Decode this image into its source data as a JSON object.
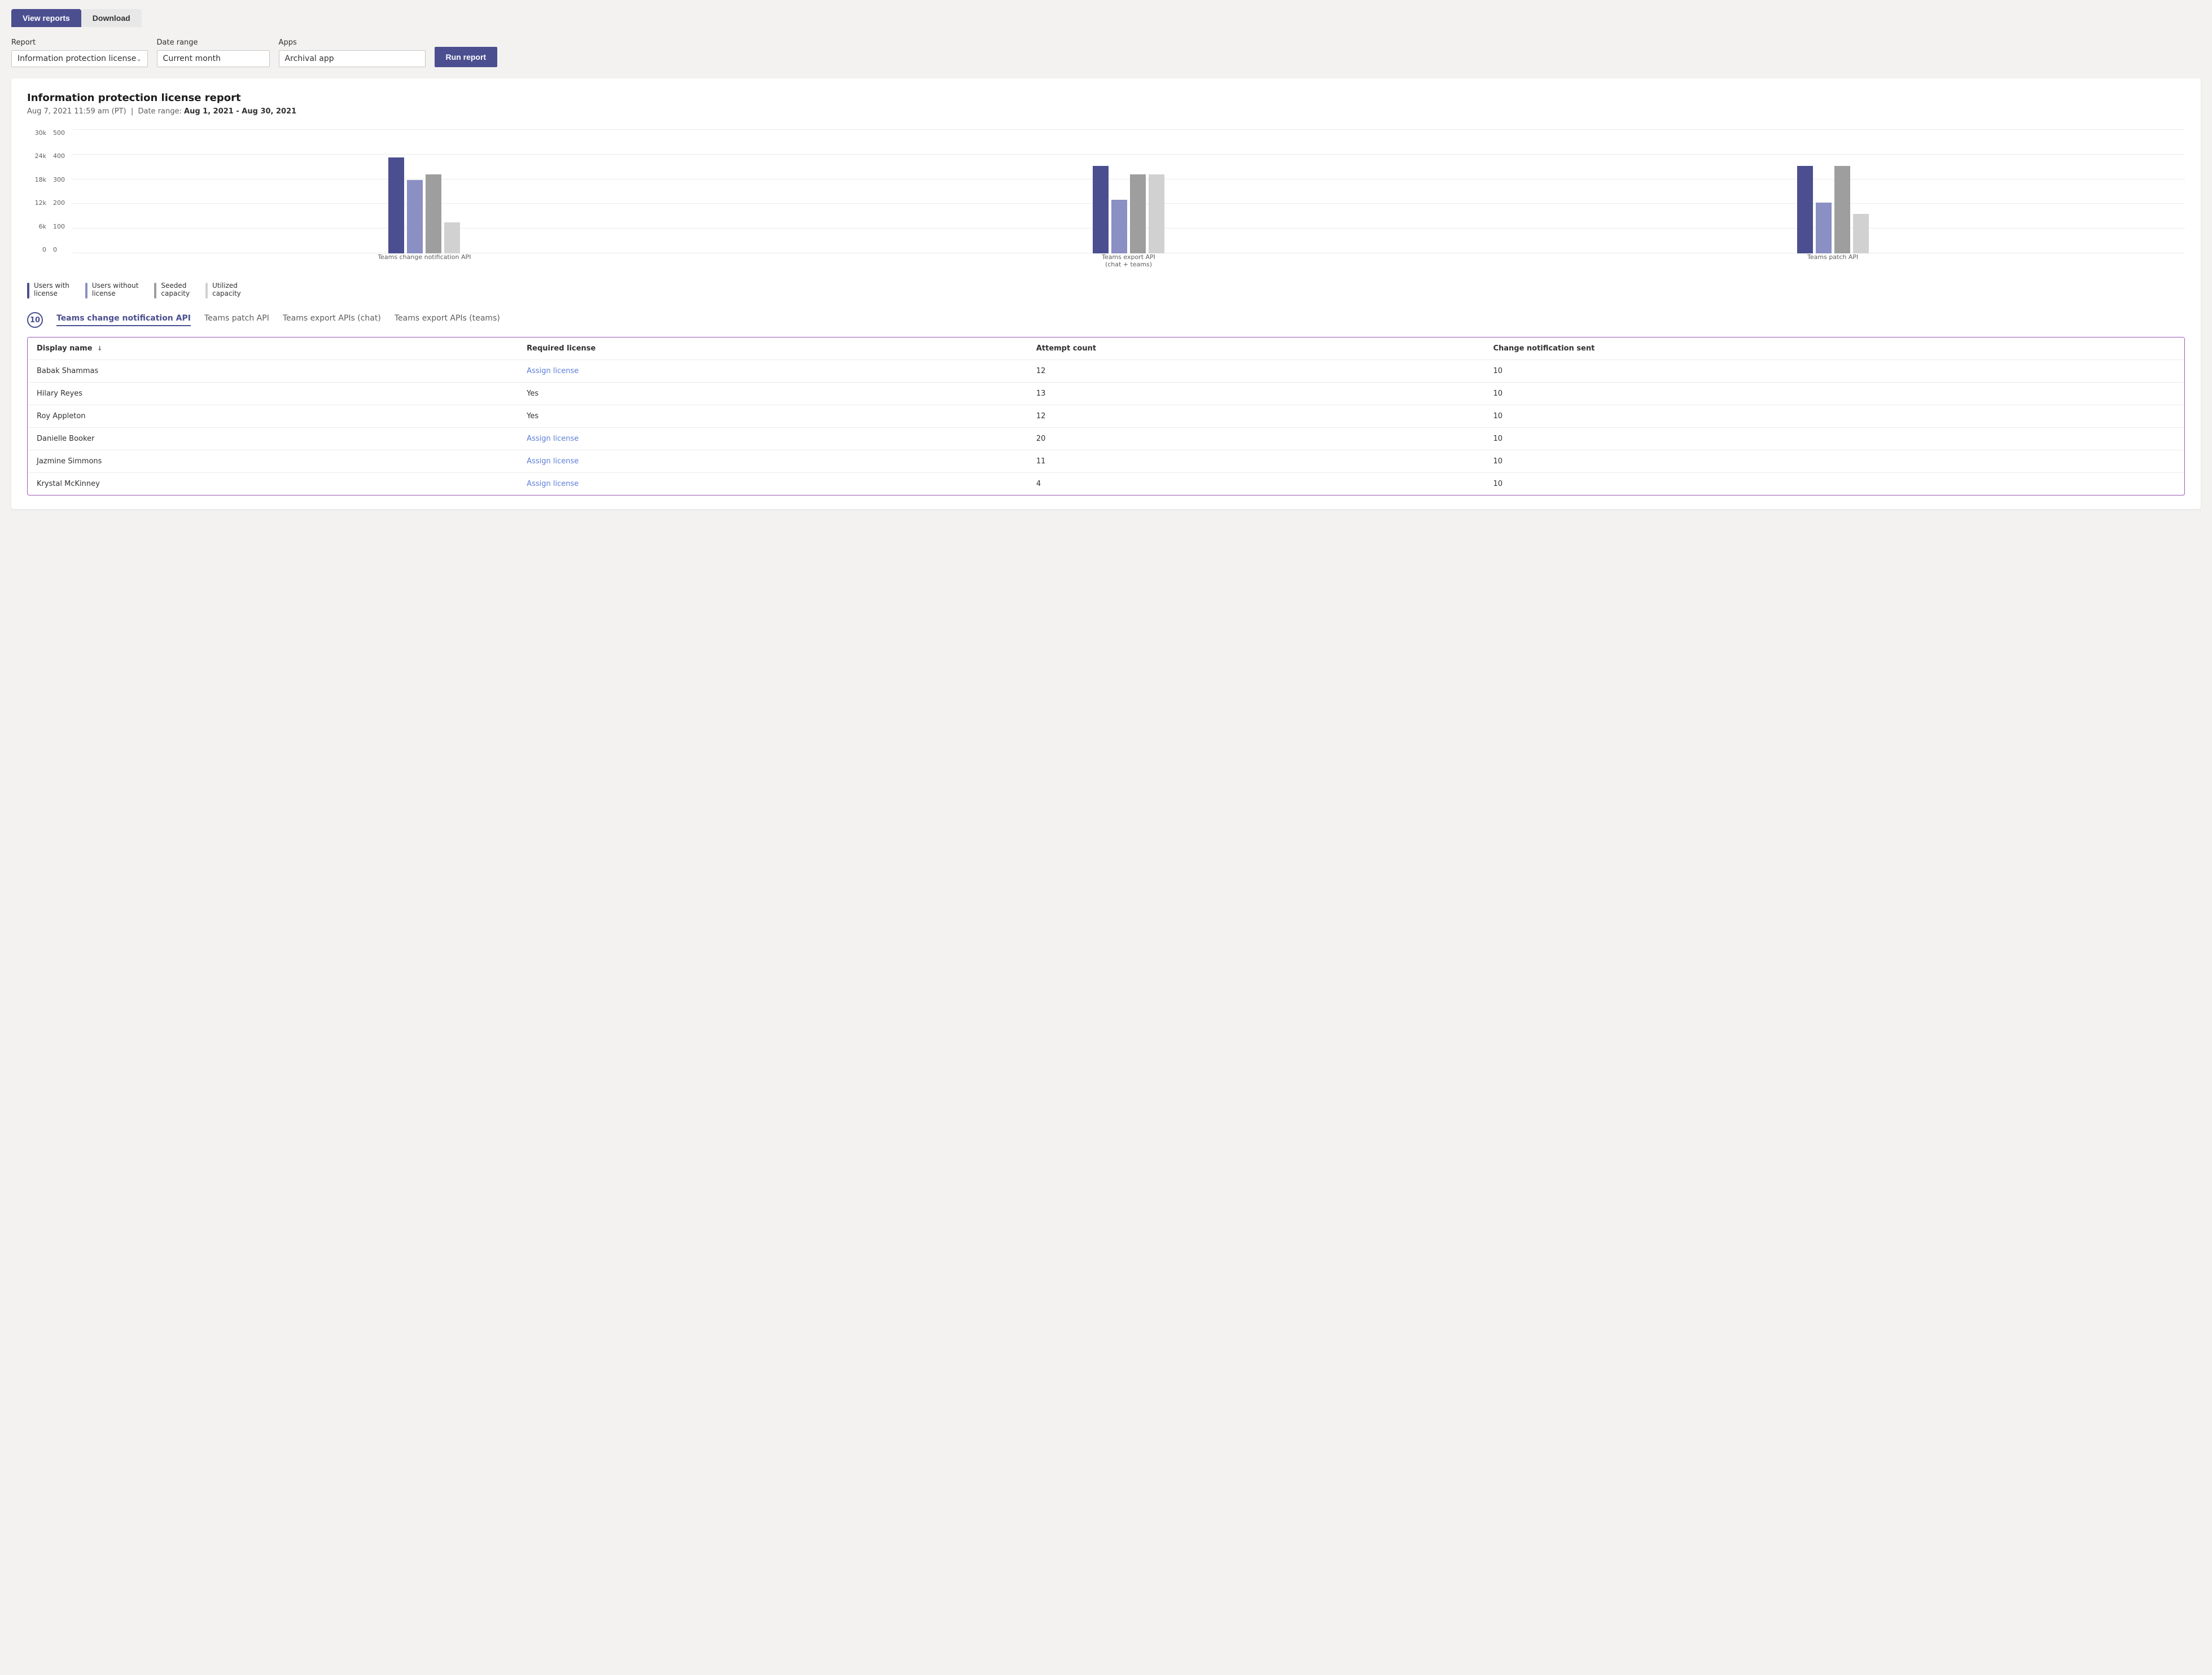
{
  "tabs": [
    {
      "id": "view-reports",
      "label": "View reports",
      "active": true
    },
    {
      "id": "download",
      "label": "Download",
      "active": false
    }
  ],
  "filters": {
    "report_label": "Report",
    "report_value": "Information protection license",
    "date_label": "Date range",
    "date_value": "Current month",
    "apps_label": "Apps",
    "apps_value": "Archival app",
    "run_report_label": "Run report"
  },
  "report": {
    "title": "Information protection license report",
    "timestamp": "Aug 7, 2021 11:59 am (PT)",
    "date_range_label": "Date range:",
    "date_range": "Aug 1, 2021 - Aug 30, 2021",
    "chart": {
      "y_axis_left": [
        "30k",
        "24k",
        "18k",
        "12k",
        "6k",
        "0"
      ],
      "y_axis_right": [
        "500",
        "400",
        "300",
        "200",
        "100",
        "0"
      ],
      "groups": [
        {
          "label": "Teams change notification API",
          "bars": [
            {
              "type": "dark-blue",
              "height": 170
            },
            {
              "type": "medium-blue",
              "height": 130
            },
            {
              "type": "medium-gray",
              "height": 140
            },
            {
              "type": "light-gray",
              "height": 55
            }
          ]
        },
        {
          "label": "Teams export API\n(chat + teams)",
          "bars": [
            {
              "type": "dark-blue",
              "height": 155
            },
            {
              "type": "medium-blue",
              "height": 95
            },
            {
              "type": "medium-gray",
              "height": 140
            },
            {
              "type": "light-gray",
              "height": 140
            }
          ]
        },
        {
          "label": "Teams patch API",
          "bars": [
            {
              "type": "dark-blue",
              "height": 155
            },
            {
              "type": "medium-blue",
              "height": 90
            },
            {
              "type": "medium-gray",
              "height": 155
            },
            {
              "type": "light-gray",
              "height": 70
            }
          ]
        }
      ],
      "legend": [
        {
          "type": "dark-blue",
          "label": "Users with\nlicense"
        },
        {
          "type": "medium-blue",
          "label": "Users without\nlicense"
        },
        {
          "type": "medium-gray",
          "label": "Seeded\ncapacity"
        },
        {
          "type": "light-gray",
          "label": "Utilized\ncapacity"
        }
      ]
    },
    "table_badge": "10",
    "table_tabs": [
      {
        "id": "change-notification",
        "label": "Teams change notification API",
        "active": true
      },
      {
        "id": "patch-api",
        "label": "Teams patch API",
        "active": false
      },
      {
        "id": "export-chat",
        "label": "Teams export APIs (chat)",
        "active": false
      },
      {
        "id": "export-teams",
        "label": "Teams export APIs (teams)",
        "active": false
      }
    ],
    "table": {
      "columns": [
        {
          "key": "display_name",
          "label": "Display name",
          "sortable": true,
          "sort_dir": "↓"
        },
        {
          "key": "required_license",
          "label": "Required license",
          "sortable": false
        },
        {
          "key": "attempt_count",
          "label": "Attempt count",
          "sortable": false
        },
        {
          "key": "change_notification_sent",
          "label": "Change notification sent",
          "sortable": false
        }
      ],
      "rows": [
        {
          "display_name": "Babak Shammas",
          "required_license": "Assign license",
          "required_license_type": "link",
          "attempt_count": "12",
          "change_notification_sent": "10"
        },
        {
          "display_name": "Hilary Reyes",
          "required_license": "Yes",
          "required_license_type": "text",
          "attempt_count": "13",
          "change_notification_sent": "10"
        },
        {
          "display_name": "Roy Appleton",
          "required_license": "Yes",
          "required_license_type": "text",
          "attempt_count": "12",
          "change_notification_sent": "10"
        },
        {
          "display_name": "Danielle Booker",
          "required_license": "Assign license",
          "required_license_type": "link",
          "attempt_count": "20",
          "change_notification_sent": "10"
        },
        {
          "display_name": "Jazmine Simmons",
          "required_license": "Assign license",
          "required_license_type": "link",
          "attempt_count": "11",
          "change_notification_sent": "10"
        },
        {
          "display_name": "Krystal McKinney",
          "required_license": "Assign license",
          "required_license_type": "link",
          "attempt_count": "4",
          "change_notification_sent": "10"
        }
      ]
    }
  }
}
